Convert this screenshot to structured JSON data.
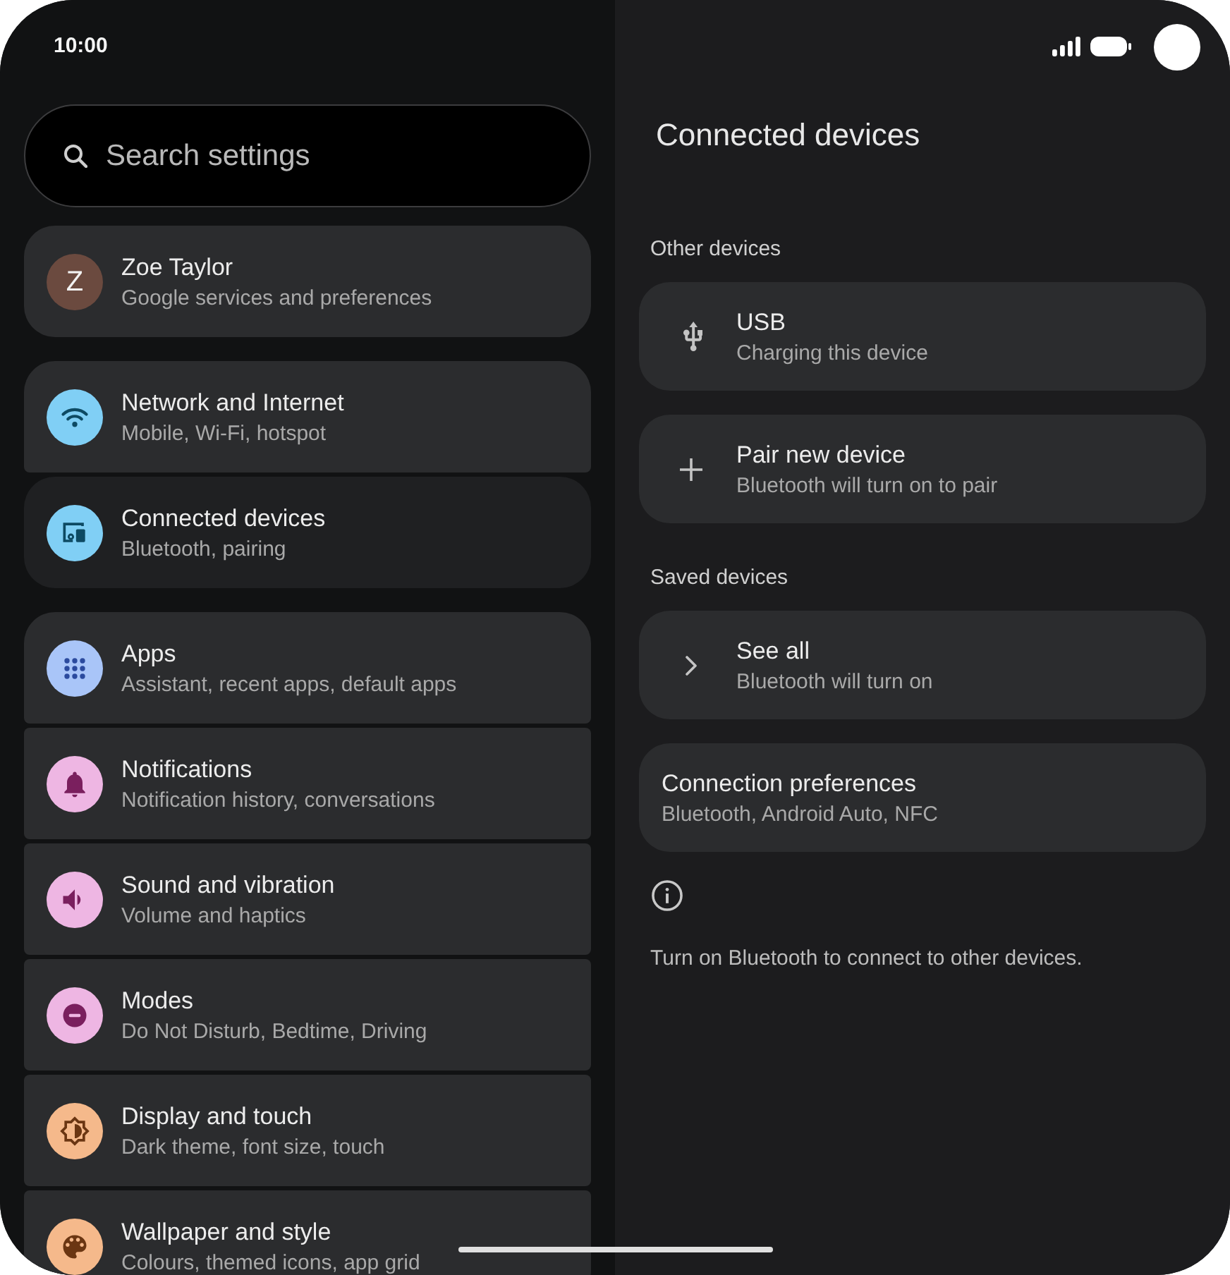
{
  "status_bar": {
    "time": "10:00"
  },
  "search": {
    "placeholder": "Search settings"
  },
  "sidebar": {
    "groups": [
      {
        "items": [
          {
            "kind": "account",
            "initial": "Z",
            "color": "#6b4a3f",
            "title": "Zoe Taylor",
            "subtitle": "Google services and preferences",
            "selected": false
          }
        ]
      },
      {
        "items": [
          {
            "kind": "category",
            "color": "#80cff5",
            "title": "Network and Internet",
            "subtitle": "Mobile, Wi-Fi, hotspot",
            "selected": false
          },
          {
            "kind": "category",
            "color": "#80cff5",
            "title": "Connected devices",
            "subtitle": "Bluetooth, pairing",
            "selected": true
          }
        ]
      },
      {
        "items": [
          {
            "kind": "category",
            "color": "#a9c5f8",
            "title": "Apps",
            "subtitle": "Assistant, recent apps, default apps",
            "selected": false
          },
          {
            "kind": "category",
            "color": "#eeb6e3",
            "title": "Notifications",
            "subtitle": "Notification history, conversations",
            "selected": false
          },
          {
            "kind": "category",
            "color": "#eeb6e3",
            "title": "Sound and vibration",
            "subtitle": "Volume and haptics",
            "selected": false
          },
          {
            "kind": "category",
            "color": "#eeb6e3",
            "title": "Modes",
            "subtitle": "Do Not Disturb, Bedtime, Driving",
            "selected": false
          },
          {
            "kind": "category",
            "color": "#f5b98b",
            "title": "Display and touch",
            "subtitle": "Dark theme, font size, touch",
            "selected": false
          },
          {
            "kind": "category",
            "color": "#f5b98b",
            "title": "Wallpaper and style",
            "subtitle": "Colours, themed icons, app grid",
            "selected": false
          }
        ]
      }
    ]
  },
  "detail": {
    "title": "Connected devices",
    "sections": [
      {
        "header": "Other devices",
        "items": [
          {
            "kind": "icon",
            "title": "USB",
            "subtitle": "Charging this device"
          },
          {
            "kind": "icon",
            "title": "Pair new device",
            "subtitle": "Bluetooth will turn on to pair"
          }
        ]
      },
      {
        "header": "Saved devices",
        "items": [
          {
            "kind": "icon",
            "title": "See all",
            "subtitle": "Bluetooth will turn on"
          }
        ]
      },
      {
        "items": [
          {
            "kind": "plain",
            "title": "Connection preferences",
            "subtitle": "Bluetooth, Android Auto, NFC"
          }
        ]
      }
    ],
    "footer": "Turn on Bluetooth to connect to other devices."
  }
}
